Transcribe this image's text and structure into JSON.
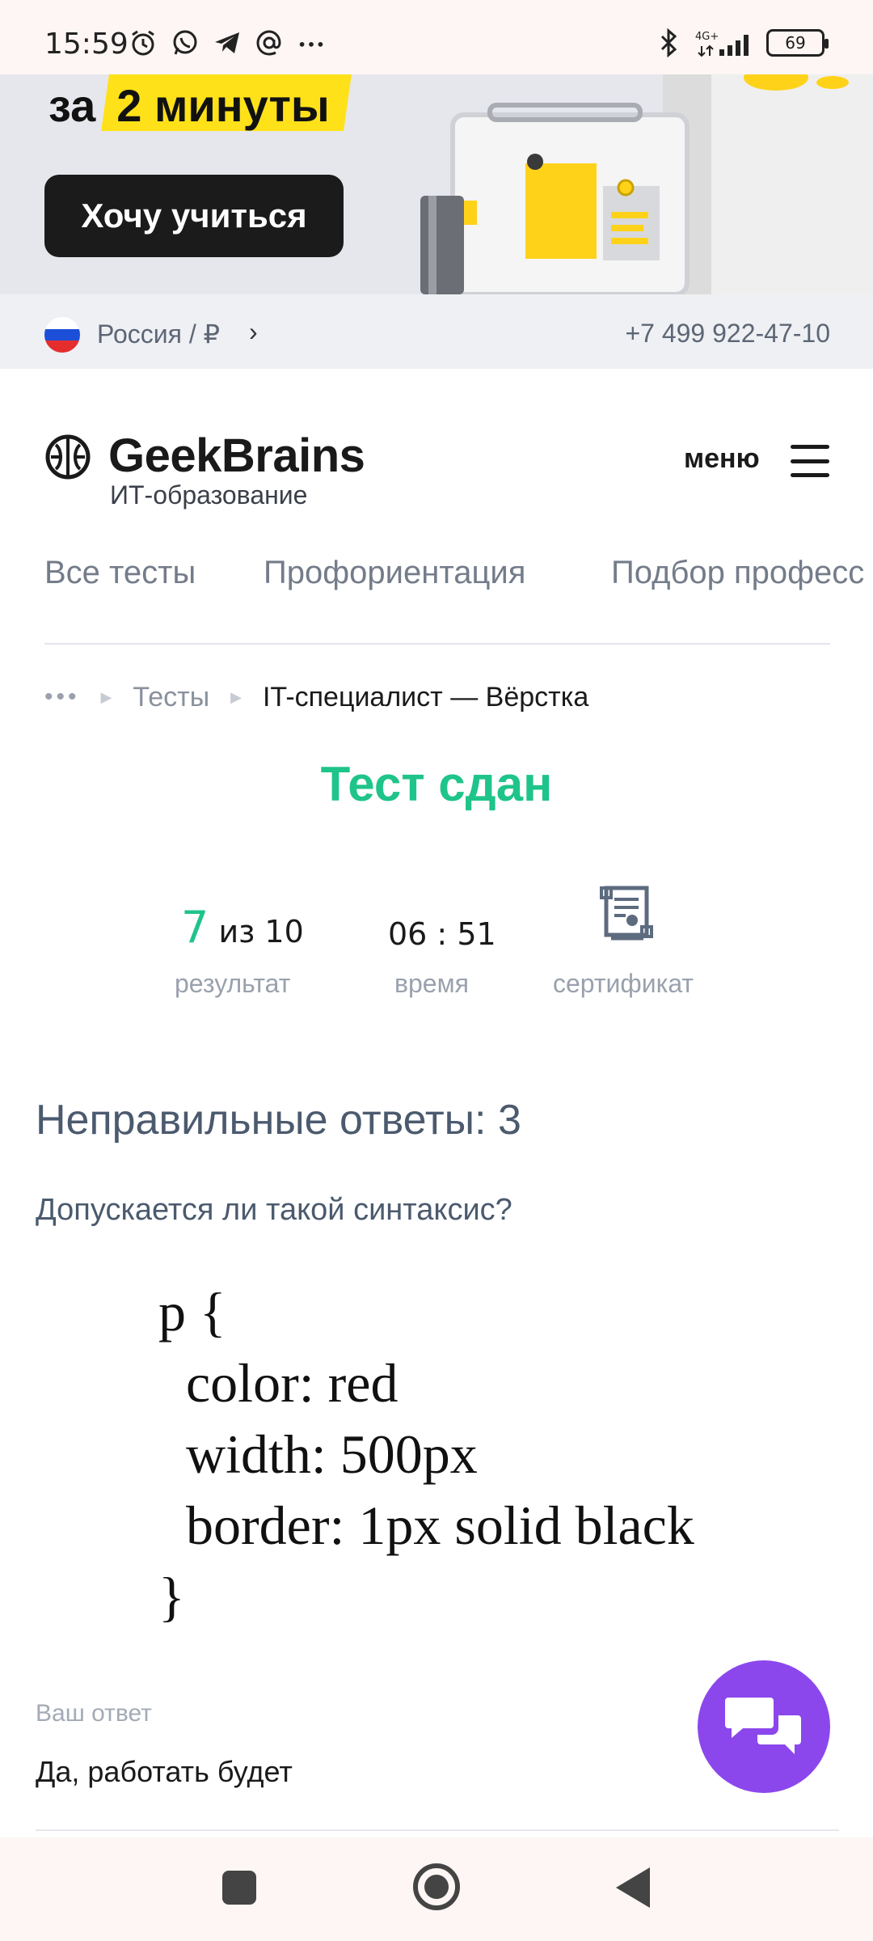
{
  "status_bar": {
    "time": "15:59",
    "network": "4G+",
    "battery": "69",
    "icons": [
      "alarm-icon",
      "whatsapp-icon",
      "telegram-icon",
      "at-icon",
      "more-icon",
      "bluetooth-icon",
      "signal-icon",
      "battery-icon"
    ]
  },
  "banner": {
    "line_prefix": "за",
    "line_highlight": "2 минуты",
    "button_label": "Хочу учиться",
    "highlight_color": "#ffe11a"
  },
  "region": {
    "label": "Россия / ₽",
    "chevron": "›",
    "phone": "+7 499 922-47-10"
  },
  "header": {
    "logo_name": "GeekBrains",
    "logo_sub": "ИТ-образование",
    "menu_label": "меню"
  },
  "nav_tabs": [
    "Все тесты",
    "Профориентация",
    "Подбор професс"
  ],
  "breadcrumb": {
    "dots": "•••",
    "link": "Тесты",
    "current": "IT-специалист — Вёрстка"
  },
  "result": {
    "title": "Тест сдан",
    "score": "7",
    "score_of": "из 10",
    "score_label": "результат",
    "time": "06 : 51",
    "time_label": "время",
    "certificate_label": "сертификат",
    "accent_color": "#1fc48a"
  },
  "wrong_answers": {
    "title": "Неправильные ответы: 3",
    "question": "Допускается ли такой синтаксис?",
    "code_lines": [
      "p {",
      "  color: red",
      "  width: 500px",
      "  border: 1px solid black",
      "}"
    ],
    "answer_label": "Ваш ответ",
    "answer_text": "Да, работать будет"
  },
  "chat_button": {
    "icon": "chat-icon",
    "color": "#8b47ec"
  },
  "system_nav": {
    "icons": [
      "recents-icon",
      "home-icon",
      "back-icon"
    ]
  }
}
